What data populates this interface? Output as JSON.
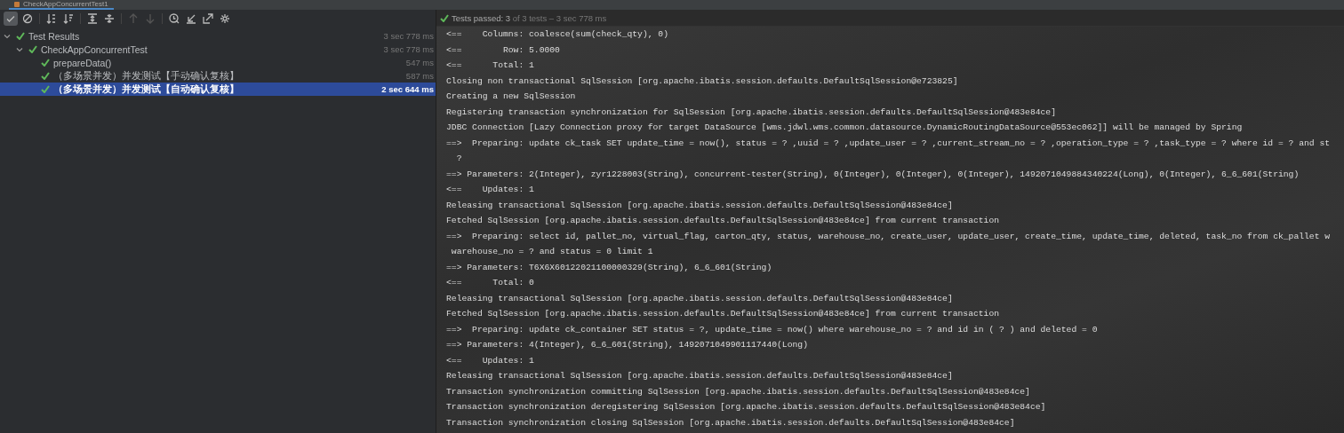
{
  "tab": {
    "title": "CheckAppConcurrentTest1"
  },
  "toolbar": [
    {
      "kind": "check",
      "pressed": true,
      "disabled": false
    },
    {
      "kind": "stop",
      "pressed": false,
      "disabled": false
    },
    {
      "kind": "sort-num",
      "pressed": false,
      "disabled": false
    },
    {
      "kind": "sort-dur",
      "pressed": false,
      "disabled": false
    },
    {
      "kind": "expand",
      "pressed": false,
      "disabled": false
    },
    {
      "kind": "collapse",
      "pressed": false,
      "disabled": false
    },
    {
      "kind": "up",
      "pressed": false,
      "disabled": true
    },
    {
      "kind": "down",
      "pressed": false,
      "disabled": true
    },
    {
      "kind": "clock",
      "pressed": false,
      "disabled": false
    },
    {
      "kind": "import",
      "pressed": false,
      "disabled": false
    },
    {
      "kind": "export",
      "pressed": false,
      "disabled": false
    },
    {
      "kind": "gear",
      "pressed": false,
      "disabled": false
    }
  ],
  "status": {
    "label": "Tests passed:",
    "count": "3",
    "rest": "of 3 tests – 3 sec 778 ms"
  },
  "tree": [
    {
      "label": "Test Results",
      "time": "3 sec 778 ms",
      "expanded": true,
      "selected": false,
      "children": [
        {
          "label": "CheckAppConcurrentTest",
          "time": "3 sec 778 ms",
          "expanded": true,
          "selected": false,
          "children": [
            {
              "label": "prepareData()",
              "time": "547 ms",
              "selected": false
            },
            {
              "label": "（多场景并发）并发测试【手动确认复核】",
              "time": "587 ms",
              "selected": false
            },
            {
              "label": "（多场景并发）并发测试【自动确认复核】",
              "time": "2 sec 644 ms",
              "selected": true
            }
          ]
        }
      ]
    }
  ],
  "console": [
    "<==    Columns: coalesce(sum(check_qty), 0)",
    "<==        Row: 5.0000",
    "<==      Total: 1",
    "Closing non transactional SqlSession [org.apache.ibatis.session.defaults.DefaultSqlSession@e723825]",
    "Creating a new SqlSession",
    "Registering transaction synchronization for SqlSession [org.apache.ibatis.session.defaults.DefaultSqlSession@483e84ce]",
    "JDBC Connection [Lazy Connection proxy for target DataSource [wms.jdwl.wms.common.datasource.DynamicRoutingDataSource@553ec062]] will be managed by Spring",
    "==>  Preparing: update ck_task SET update_time = now(), status = ? ,uuid = ? ,update_user = ? ,current_stream_no = ? ,operation_type = ? ,task_type = ? where id = ? and st",
    "  ?",
    "==> Parameters: 2(Integer), zyr1228003(String), concurrent-tester(String), 0(Integer), 0(Integer), 0(Integer), 1492071049884340224(Long), 0(Integer), 6_6_601(String)",
    "<==    Updates: 1",
    "Releasing transactional SqlSession [org.apache.ibatis.session.defaults.DefaultSqlSession@483e84ce]",
    "Fetched SqlSession [org.apache.ibatis.session.defaults.DefaultSqlSession@483e84ce] from current transaction",
    "==>  Preparing: select id, pallet_no, virtual_flag, carton_qty, status, warehouse_no, create_user, update_user, create_time, update_time, deleted, task_no from ck_pallet w",
    " warehouse_no = ? and status = 0 limit 1",
    "==> Parameters: T6X6X60122021100000329(String), 6_6_601(String)",
    "<==      Total: 0",
    "Releasing transactional SqlSession [org.apache.ibatis.session.defaults.DefaultSqlSession@483e84ce]",
    "Fetched SqlSession [org.apache.ibatis.session.defaults.DefaultSqlSession@483e84ce] from current transaction",
    "==>  Preparing: update ck_container SET status = ?, update_time = now() where warehouse_no = ? and id in ( ? ) and deleted = 0",
    "==> Parameters: 4(Integer), 6_6_601(String), 1492071049901117440(Long)",
    "<==    Updates: 1",
    "Releasing transactional SqlSession [org.apache.ibatis.session.defaults.DefaultSqlSession@483e84ce]",
    "Transaction synchronization committing SqlSession [org.apache.ibatis.session.defaults.DefaultSqlSession@483e84ce]",
    "Transaction synchronization deregistering SqlSession [org.apache.ibatis.session.defaults.DefaultSqlSession@483e84ce]",
    "Transaction synchronization closing SqlSession [org.apache.ibatis.session.defaults.DefaultSqlSession@483e84ce]"
  ]
}
